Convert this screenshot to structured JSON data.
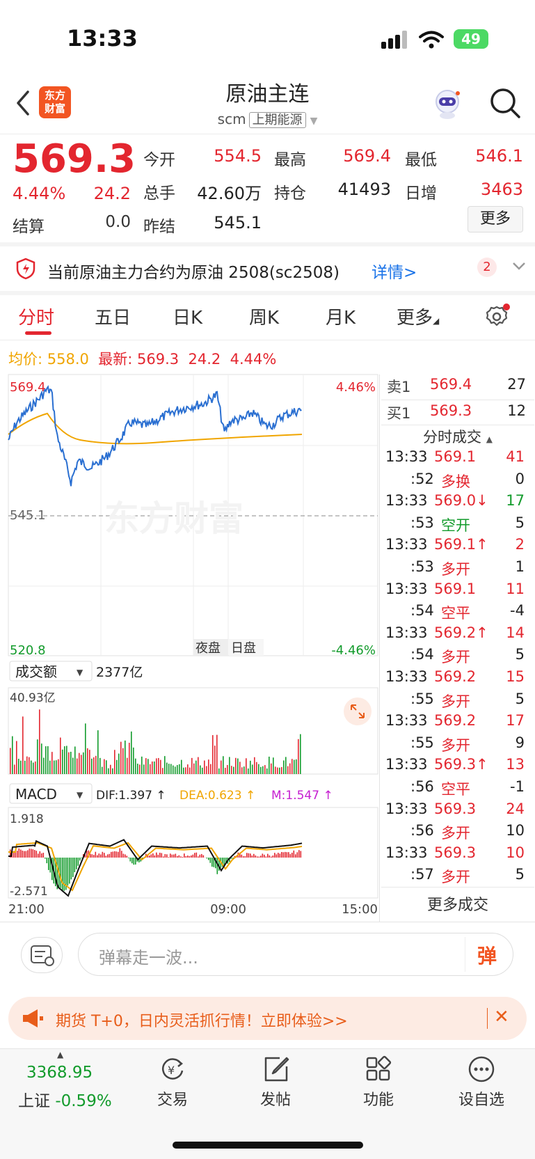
{
  "status": {
    "time": "13:33",
    "battery": "49"
  },
  "header": {
    "logo": "东方\n财富",
    "title": "原油主连",
    "code": "scm",
    "exchange": "上期能源"
  },
  "quote": {
    "price": "569.3",
    "pct": "4.44%",
    "change": "24.2",
    "settle_label": "结算",
    "settle_value": "0.0",
    "open_label": "今开",
    "open": "554.5",
    "high_label": "最高",
    "high": "569.4",
    "low_label": "最低",
    "low": "546.1",
    "volume_label": "总手",
    "volume": "42.60万",
    "oi_label": "持仓",
    "oi": "41493",
    "inc_label": "日增",
    "inc": "3463",
    "prev_label": "昨结",
    "prev": "545.1",
    "more_label": "更多"
  },
  "notice": {
    "text": "当前原油主力合约为原油 2508(sc2508)",
    "link": "详情>",
    "badge": "2"
  },
  "tabs": [
    "分时",
    "五日",
    "日K",
    "周K",
    "月K",
    "更多"
  ],
  "avg_bar": {
    "avg_label": "均价:",
    "avg": "558.0",
    "latest_label": "最新:",
    "latest": "569.3",
    "chg": "24.2",
    "pct": "4.44%"
  },
  "chart": {
    "top_price": "569.4",
    "top_pct": "4.46%",
    "mid_price": "545.1",
    "bottom_price": "520.8",
    "bottom_pct": "-4.46%",
    "session_night": "夜盘",
    "session_day": "日盘",
    "volume_selector": "成交额",
    "volume_total": "2377亿",
    "volume_max": "40.93亿",
    "macd_selector": "MACD",
    "dif": "DIF:1.397 ↑",
    "dea": "DEA:0.623 ↑",
    "m": "M:1.547 ↑",
    "macd_max": "1.918",
    "macd_min": "-2.571",
    "time_start": "21:00",
    "time_mid": "09:00",
    "time_end": "15:00",
    "watermark": "东方财富"
  },
  "orderbook": {
    "ask_label": "卖1",
    "ask_price": "569.4",
    "ask_qty": "27",
    "bid_label": "买1",
    "bid_price": "569.3",
    "bid_qty": "12",
    "ticks_title": "分时成交",
    "more_ticks": "更多成交"
  },
  "ticks": [
    {
      "t": "13:33",
      "p": "569.1",
      "q": "41",
      "pc": "red",
      "qc": "red"
    },
    {
      "t": ":52",
      "p": "多换",
      "q": "0",
      "pc": "red",
      "qc": "dark"
    },
    {
      "t": "13:33",
      "p": "569.0↓",
      "q": "17",
      "pc": "red",
      "qc": "green"
    },
    {
      "t": ":53",
      "p": "空开",
      "q": "5",
      "pc": "green",
      "qc": "dark"
    },
    {
      "t": "13:33",
      "p": "569.1↑",
      "q": "2",
      "pc": "red",
      "qc": "red"
    },
    {
      "t": ":53",
      "p": "多开",
      "q": "1",
      "pc": "red",
      "qc": "dark"
    },
    {
      "t": "13:33",
      "p": "569.1",
      "q": "11",
      "pc": "red",
      "qc": "red"
    },
    {
      "t": ":54",
      "p": "空平",
      "q": "-4",
      "pc": "red",
      "qc": "dark"
    },
    {
      "t": "13:33",
      "p": "569.2↑",
      "q": "14",
      "pc": "red",
      "qc": "red"
    },
    {
      "t": ":54",
      "p": "多开",
      "q": "5",
      "pc": "red",
      "qc": "dark"
    },
    {
      "t": "13:33",
      "p": "569.2",
      "q": "15",
      "pc": "red",
      "qc": "red"
    },
    {
      "t": ":55",
      "p": "多开",
      "q": "5",
      "pc": "red",
      "qc": "dark"
    },
    {
      "t": "13:33",
      "p": "569.2",
      "q": "17",
      "pc": "red",
      "qc": "red"
    },
    {
      "t": ":55",
      "p": "多开",
      "q": "9",
      "pc": "red",
      "qc": "dark"
    },
    {
      "t": "13:33",
      "p": "569.3↑",
      "q": "13",
      "pc": "red",
      "qc": "red"
    },
    {
      "t": ":56",
      "p": "空平",
      "q": "-1",
      "pc": "red",
      "qc": "dark"
    },
    {
      "t": "13:33",
      "p": "569.3",
      "q": "24",
      "pc": "red",
      "qc": "red"
    },
    {
      "t": ":56",
      "p": "多开",
      "q": "10",
      "pc": "red",
      "qc": "dark"
    },
    {
      "t": "13:33",
      "p": "569.3",
      "q": "10",
      "pc": "red",
      "qc": "red"
    },
    {
      "t": ":57",
      "p": "多开",
      "q": "5",
      "pc": "red",
      "qc": "dark"
    }
  ],
  "comment": {
    "placeholder": "弹幕走一波...",
    "send": "弹"
  },
  "ad": {
    "text": "期货 T+0，日内灵活抓行情！立即体验>>",
    "close": "✕"
  },
  "bottom_nav": {
    "index_value": "3368.95",
    "index_name": "上证",
    "index_pct": "-0.59%",
    "items": [
      "交易",
      "发帖",
      "功能",
      "设自选"
    ]
  }
}
